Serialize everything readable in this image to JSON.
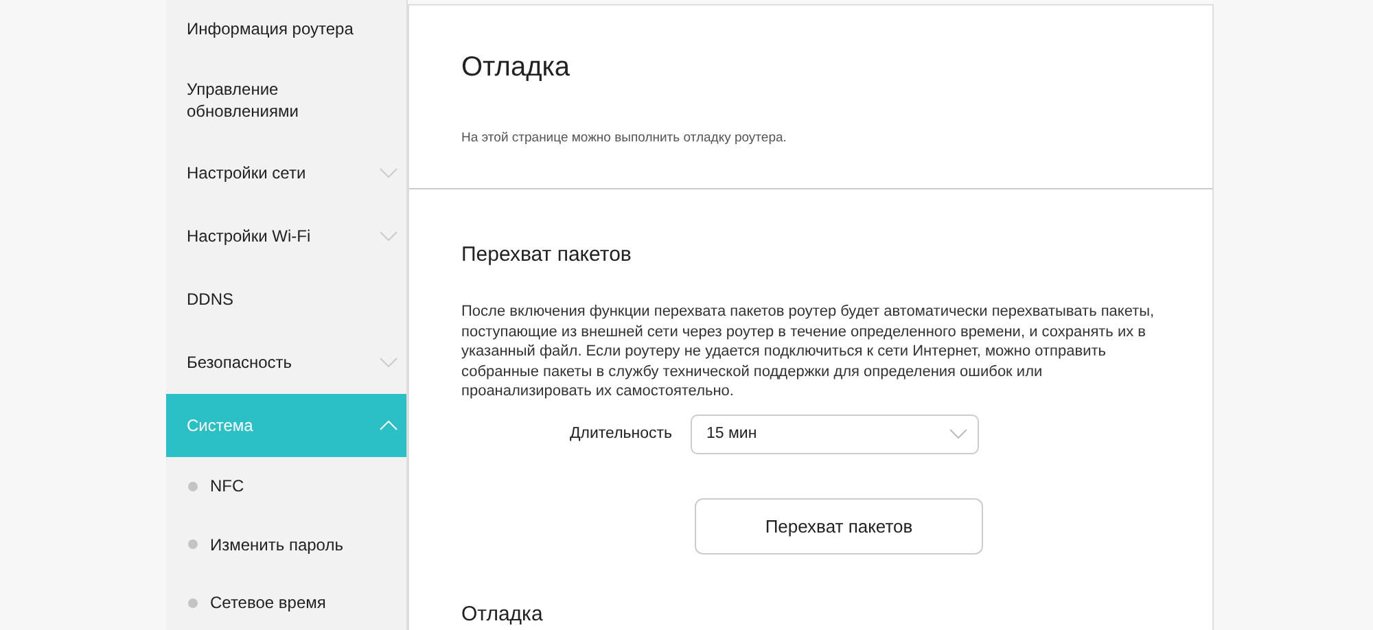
{
  "sidebar": {
    "items": [
      {
        "label": "Информация роутера",
        "selected": false
      },
      {
        "label": "Управление обновлениями",
        "selected": false
      },
      {
        "label": "Настройки сети",
        "selected": false,
        "expanded": false
      },
      {
        "label": "Настройки Wi-Fi",
        "selected": false,
        "expanded": false
      },
      {
        "label": "DDNS",
        "selected": false
      },
      {
        "label": "Безопасность",
        "selected": false,
        "expanded": false
      },
      {
        "label": "Система",
        "selected": true,
        "expanded": true,
        "children": [
          {
            "label": "NFC",
            "selected": false
          },
          {
            "label": "Изменить пароль",
            "selected": false
          },
          {
            "label": "Сетевое время",
            "selected": false
          }
        ]
      }
    ]
  },
  "page": {
    "title": "Отладка",
    "description": "На этой странице можно выполнить отладку роутера."
  },
  "capture": {
    "heading": "Перехват пакетов",
    "text": "После включения функции перехвата пакетов роутер будет автоматически перехватывать пакеты, поступающие из внешней сети через роутер в течение определенного времени, и сохранять их в указанный файл. Если роутеру не удается подключиться к сети Интернет, можно отправить собранные пакеты в службу технической поддержки для определения ошибок или проанализировать их самостоятельно.",
    "duration_label": "Длительность",
    "duration_value": "15 мин",
    "button": "Перехват пакетов"
  },
  "next_section": {
    "heading": "Отладка"
  }
}
